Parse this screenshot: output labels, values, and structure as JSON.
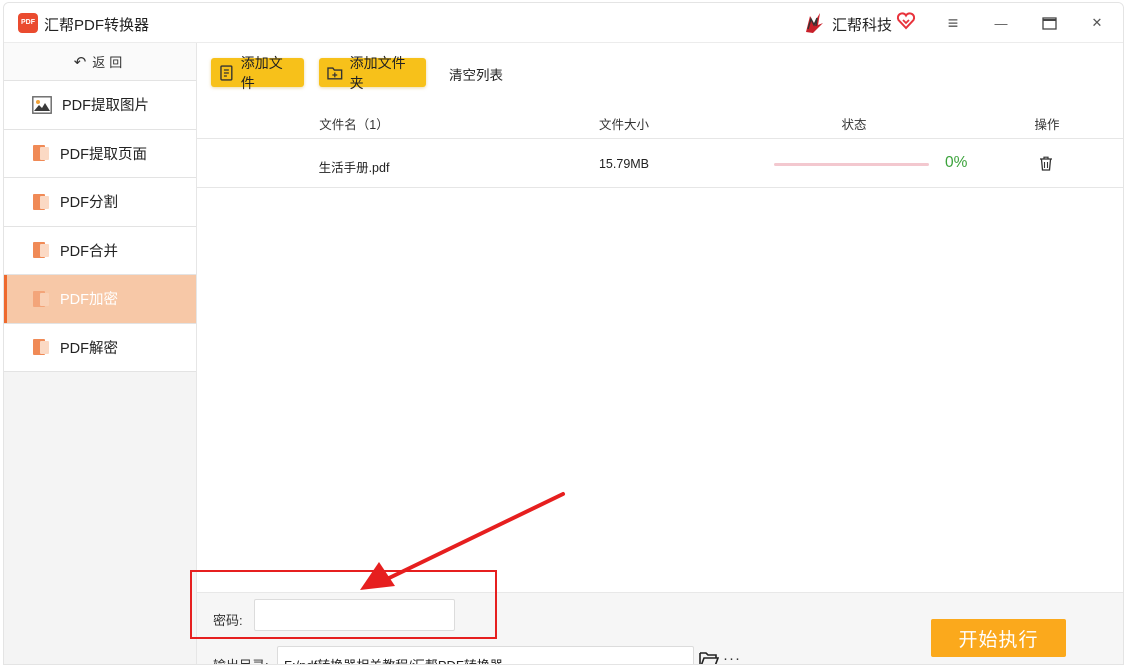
{
  "window": {
    "app_logo_text": "PDF",
    "title": "汇帮PDF转换器",
    "brand_name": "汇帮科技",
    "menu_icon": "≡",
    "minimize_icon": "—",
    "close_icon": "✕"
  },
  "sidebar": {
    "back_label": "返回",
    "back_icon": "↶",
    "items": [
      {
        "label": "PDF提取图片",
        "icon": "image-icon",
        "active": false
      },
      {
        "label": "PDF提取页面",
        "icon": "pdf-doc-icon",
        "active": false
      },
      {
        "label": "PDF分割",
        "icon": "pdf-doc-icon",
        "active": false
      },
      {
        "label": "PDF合并",
        "icon": "pdf-doc-icon",
        "active": false
      },
      {
        "label": "PDF加密",
        "icon": "pdf-doc-icon",
        "active": true
      },
      {
        "label": "PDF解密",
        "icon": "pdf-doc-icon",
        "active": false
      }
    ]
  },
  "toolbar": {
    "add_file_label": "添加文件",
    "add_folder_label": "添加文件夹",
    "clear_list_label": "清空列表"
  },
  "table": {
    "columns": [
      "文件名（1）",
      "文件大小",
      "状态",
      "操作"
    ],
    "rows": [
      {
        "name": "生活手册.pdf",
        "size": "15.79MB",
        "progress_percent": 0,
        "status_text": "0%"
      }
    ]
  },
  "options": {
    "password_label": "密码:",
    "password_value": "",
    "output_label": "输出目录:",
    "output_path": "F:/pdf转换器相关教程/汇帮PDF转换器",
    "more_label": "···",
    "start_label": "开始执行"
  },
  "colors": {
    "accent_orange": "#fba91c",
    "button_yellow": "#f7c11a",
    "active_nav_bg": "#f7c8a7",
    "annotation_red": "#e61f1f",
    "progress_green": "#3aa23a"
  }
}
